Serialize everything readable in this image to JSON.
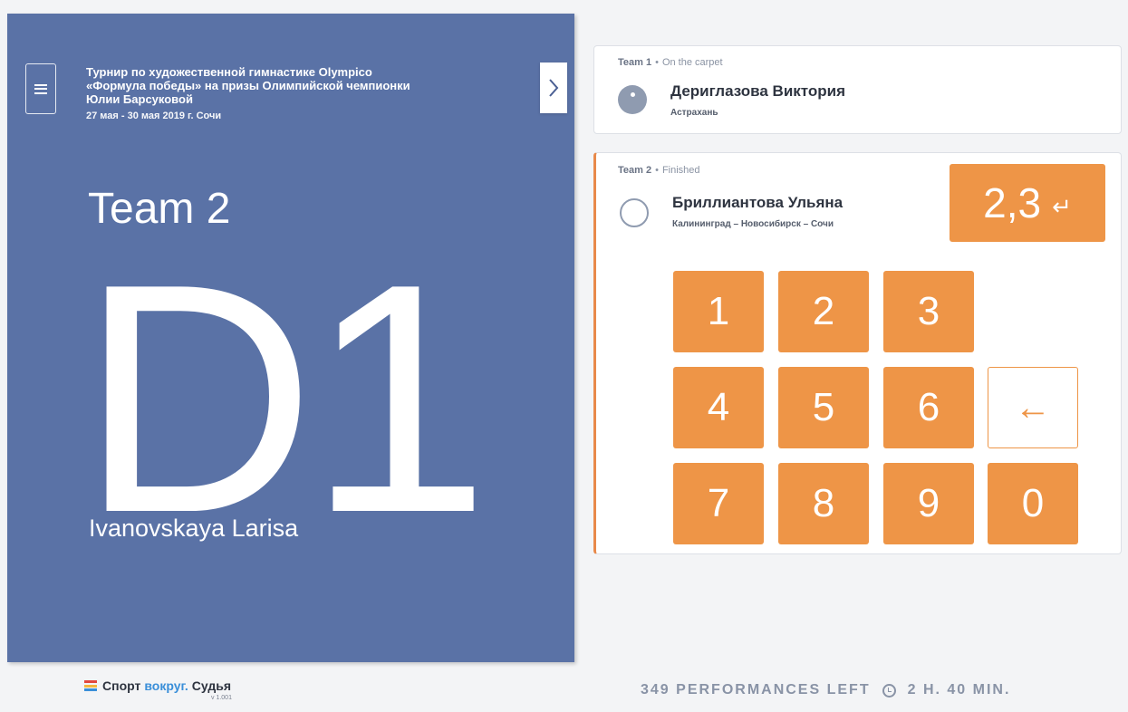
{
  "tournament": {
    "title_line1": "Турнир по художественной гимнастике Olympico",
    "title_line2": "«Формула победы» на призы Олимпийской чемпионки",
    "title_line3": "Юлии Барсуковой",
    "dates": "27 мая - 30 мая 2019 г. Сочи"
  },
  "panel": {
    "team": "Team 2",
    "judge_role": "D1",
    "judge_name": "Ivanovskaya Larisa"
  },
  "performances": [
    {
      "team": "Team 1",
      "status": "On the carpet",
      "athlete": "Дериглазова Виктория",
      "city": "Астрахань"
    },
    {
      "team": "Team 2",
      "status": "Finished",
      "athlete": "Бриллиантова Ульяна",
      "city": "Калининград – Новосибирск – Сочи",
      "score": "2,3"
    }
  ],
  "keypad": {
    "k1": "1",
    "k2": "2",
    "k3": "3",
    "k4": "4",
    "k5": "5",
    "k6": "6",
    "k7": "7",
    "k8": "8",
    "k9": "9",
    "k0": "0",
    "backspace": "←",
    "enter": "↵"
  },
  "footer": {
    "brand_part1": "Спорт",
    "brand_accent": "вокруг.",
    "brand_part2": "Судья",
    "version": "v 1.001",
    "performances_left": "349 PERFORMANCES LEFT",
    "time_left": "2 H. 40 MIN."
  },
  "colors": {
    "panel_blue": "#5a72a6",
    "accent_orange": "#ee9547",
    "brand_blue": "#3a8fd9"
  },
  "icons": {
    "menu": "menu-icon",
    "expand": "chevron-right-icon",
    "clock": "clock-icon"
  }
}
